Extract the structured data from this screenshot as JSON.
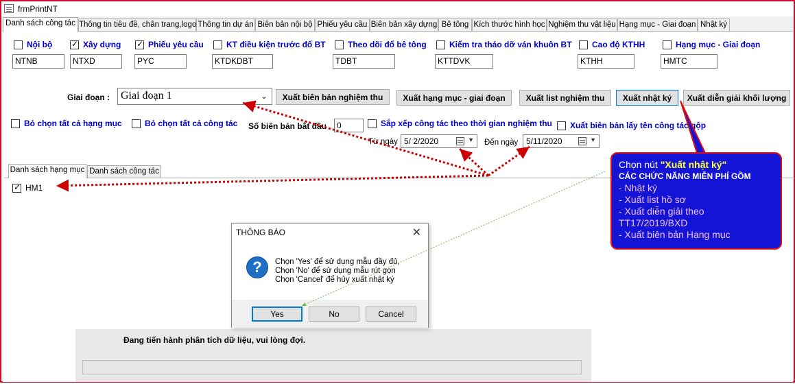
{
  "window": {
    "title": "frmPrintNT",
    "icon": "form-icon"
  },
  "tabs": [
    {
      "label": "Danh sách công tác",
      "active": true
    },
    {
      "label": "Thông tin tiêu đề, chân trang,logo"
    },
    {
      "label": "Thông tin dự án"
    },
    {
      "label": "Biên bản nội bộ"
    },
    {
      "label": "Phiếu yêu cầu"
    },
    {
      "label": "Biên bản xây dựng"
    },
    {
      "label": "Bê tông"
    },
    {
      "label": "Kích thước hình học"
    },
    {
      "label": "Nghiệm thu vật liệu"
    },
    {
      "label": "Hạng mục - Giai đoạn"
    },
    {
      "label": "Nhật ký"
    }
  ],
  "categories": [
    {
      "label": "Nội bộ",
      "checked": false,
      "code": "NTNB"
    },
    {
      "label": "Xây dựng",
      "checked": true,
      "code": "NTXD"
    },
    {
      "label": "Phiếu yêu cầu",
      "checked": true,
      "code": "PYC"
    },
    {
      "label": "KT điều kiện trước đổ BT",
      "checked": false,
      "code": "KTDKDBT"
    },
    {
      "label": "Theo dõi đổ bê tông",
      "checked": false,
      "code": "TDBT"
    },
    {
      "label": "Kiểm tra tháo dỡ ván khuôn BT",
      "checked": false,
      "code": "KTTDVK"
    },
    {
      "label": "Cao độ KTHH",
      "checked": false,
      "code": "KTHH"
    },
    {
      "label": "Hạng mục - Giai đoạn",
      "checked": false,
      "code": "HMTC"
    }
  ],
  "phase": {
    "label": "Giai đoạn :",
    "value": "Giai đoạn 1"
  },
  "actions": {
    "export_report": "Xuất biên bản nghiệm thu",
    "export_phase": "Xuất hạng mục - giai đoạn",
    "export_list": "Xuất list nghiệm thu",
    "export_diary": "Xuất nhật ký",
    "export_volume": "Xuất diễn giải khối lượng"
  },
  "options": {
    "unselect_items": "Bỏ chọn tất cả hạng mục",
    "unselect_tasks": "Bỏ chọn tất cả công tác",
    "start_number_label": "Số biên bản bắt đầu",
    "start_number": "0",
    "sort_by_time": "Sắp xếp công tác theo thời gian nghiệm thu",
    "use_group_name": "Xuất biên bản lấy tên công tác gộp",
    "from_label": "Từ ngày",
    "from_date": "5/  2/2020",
    "to_label": "Đến ngày",
    "to_date": "5/11/2020"
  },
  "subtabs": [
    {
      "label": "Danh sách hạng mục",
      "active": true
    },
    {
      "label": "Danh sách công tác"
    }
  ],
  "items": [
    {
      "label": "HM1",
      "checked": true
    }
  ],
  "dialog": {
    "title": "THÔNG BÁO",
    "close": "✕",
    "icon": "question-icon",
    "lines": [
      "Chọn 'Yes' để sử dụng mẫu đầy đủ,",
      "Chọn 'No' để sử dụng mẫu rút gọn",
      "Chọn 'Cancel' để hủy xuất nhật ký"
    ],
    "yes": "Yes",
    "no": "No",
    "cancel": "Cancel"
  },
  "progress": {
    "text": "Đang tiến hành phân tích dữ liệu, vui lòng đợi.",
    "value": 0
  },
  "callout": {
    "prefix": "Chọn nút ",
    "highlight": "\"Xuất nhật ký\"",
    "subtitle": "CÁC CHỨC NĂNG MIỄN PHÍ GỒM",
    "items": [
      "- Nhật ký",
      "- Xuất list hồ sơ",
      "- Xuất diễn giải theo TT17/2019/BXD",
      "- Xuất biên bản Hạng mục"
    ]
  },
  "colors": {
    "accent": "#0000cc",
    "callout_bg": "#1414d6",
    "callout_border": "#dd1111",
    "highlight": "#ffff33",
    "arrow": "#cc0000"
  }
}
